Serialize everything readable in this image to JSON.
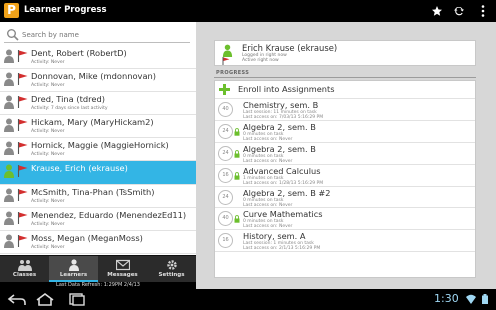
{
  "app": {
    "title": "Learner Progress",
    "logo": "learner-progress-logo",
    "accent": "#33b5e5"
  },
  "actionbar": {
    "icons": [
      "star-icon",
      "sync-icon",
      "overflow-menu-icon"
    ]
  },
  "search": {
    "placeholder": "Search by name",
    "value": ""
  },
  "learners": [
    {
      "name": "Dent, Robert (RobertD)",
      "activity": "Activity: Never",
      "selected": false
    },
    {
      "name": "Donnovan, Mike (mdonnovan)",
      "activity": "Activity: Never",
      "selected": false
    },
    {
      "name": "Dred, Tina (tdred)",
      "activity": "Activity: 7 days since last activity",
      "selected": false
    },
    {
      "name": "Hickam, Mary (MaryHickam2)",
      "activity": "Activity: Never",
      "selected": false
    },
    {
      "name": "Hornick, Maggie (MaggieHornick)",
      "activity": "Activity: Never",
      "selected": false
    },
    {
      "name": "Krause, Erich (ekrause)",
      "activity": "",
      "selected": true
    },
    {
      "name": "McSmith, Tina-Phan (TsSmith)",
      "activity": "Activity: Never",
      "selected": false
    },
    {
      "name": "Menendez, Eduardo (MenendezEd11)",
      "activity": "Activity: Never",
      "selected": false
    },
    {
      "name": "Moss, Megan (MeganMoss)",
      "activity": "Activity: Never",
      "selected": false
    }
  ],
  "nav": [
    {
      "label": "Classes",
      "icon": "classes-icon",
      "active": false
    },
    {
      "label": "Learners",
      "icon": "learners-icon",
      "active": true
    },
    {
      "label": "Messages",
      "icon": "messages-icon",
      "active": false
    },
    {
      "label": "Settings",
      "icon": "settings-icon",
      "active": false
    }
  ],
  "footer": {
    "last_refresh": "Last Data Refresh: 1:29PM 2/4/13"
  },
  "detail": {
    "name": "Erich Krause (ekrause)",
    "sub1": "Logged in right now",
    "sub2": "Active right now",
    "progress_label": "PROGRESS",
    "enroll_label": "Enroll into Assignments",
    "courses": [
      {
        "title": "Chemistry, sem. B",
        "score": "40",
        "locked": false,
        "line1": "Last session: 11 minutes on task",
        "line2": "Last access on: 7/03/13 5:16:29 PM"
      },
      {
        "title": "Algebra 2, sem. B",
        "score": "24",
        "locked": true,
        "line1": "0 minutes on task",
        "line2": "Last access on: Never"
      },
      {
        "title": "Algebra 2, sem. B",
        "score": "24",
        "locked": true,
        "line1": "0 minutes on task",
        "line2": "Last access on: Never"
      },
      {
        "title": "Advanced Calculus",
        "score": "16",
        "locked": true,
        "line1": "1 minutes on task",
        "line2": "Last access on: 1/28/13 5:16:29 PM"
      },
      {
        "title": "Algebra 2, sem. B #2",
        "score": "24",
        "locked": false,
        "line1": "0 minutes on task",
        "line2": "Last access on: Never"
      },
      {
        "title": "Curve Mathematics",
        "score": "40",
        "locked": true,
        "line1": "0 minutes on task",
        "line2": "Last access on: Never"
      },
      {
        "title": "History, sem. A",
        "score": "16",
        "locked": false,
        "line1": "Last session: 1 minutes on task",
        "line2": "Last access on: 2/1/13 5:16:29 PM"
      }
    ]
  },
  "system": {
    "time": "1:30",
    "nav_icons": [
      "back-icon",
      "home-icon",
      "recent-apps-icon"
    ],
    "status_icons": [
      "wifi-icon",
      "battery-icon"
    ]
  }
}
